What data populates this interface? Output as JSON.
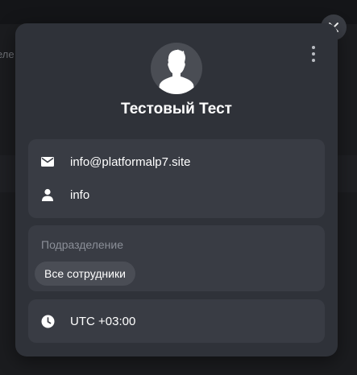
{
  "background": {
    "partial_text": "еле"
  },
  "profile": {
    "name": "Тестовый Тест",
    "email": "info@platformalp7.site",
    "login": "info",
    "division_label": "Подразделение",
    "division_value": "Все сотрудники",
    "timezone": "UTC +03:00"
  },
  "icons": {
    "close": "close-icon",
    "menu": "more-vertical-icon",
    "avatar": "user-silhouette",
    "email": "mail-icon",
    "login": "person-icon",
    "timezone": "clock-icon"
  },
  "colors": {
    "card": "#2f3239",
    "section": "#393c44",
    "chip": "#4a4d55",
    "text": "#ffffff",
    "muted": "#8b8f98"
  }
}
